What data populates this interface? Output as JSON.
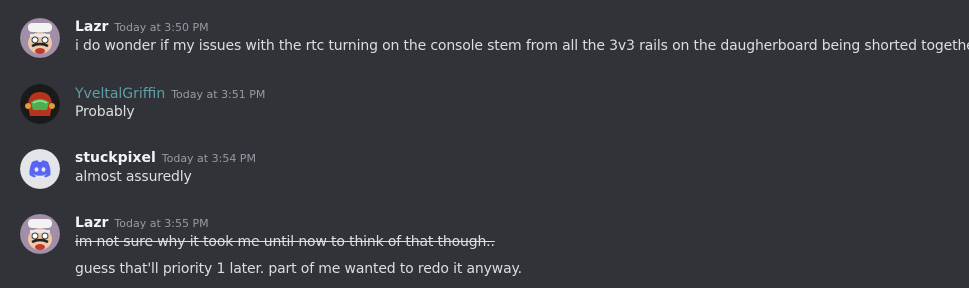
{
  "messages": [
    {
      "author": "Lazr",
      "timestamp": "Today at 3:50 PM",
      "avatar": "lazr-avatar",
      "lines": [
        {
          "text": "i do wonder if my issues with the rtc turning on the console stem from all the 3v3 rails on the daugherboard being shorted together",
          "strike": false
        }
      ]
    },
    {
      "author": "YveltalGriffin",
      "timestamp": "Today at 3:51 PM",
      "avatar": "helmet-avatar",
      "author_color": "#5e9ea6",
      "lines": [
        {
          "text": "Probably",
          "strike": false
        }
      ]
    },
    {
      "author": "stuckpixel",
      "timestamp": "Today at 3:54 PM",
      "avatar": "discord-default-avatar",
      "lines": [
        {
          "text": "almost assuredly",
          "strike": false
        }
      ]
    },
    {
      "author": "Lazr",
      "timestamp": "Today at 3:55 PM",
      "avatar": "lazr-avatar",
      "lines": [
        {
          "text": "im not sure why it took me until now to think of that though..",
          "strike": true
        },
        {
          "text": "guess that'll priority 1 later. part of me wanted to redo it anyway.",
          "strike": false
        }
      ]
    }
  ],
  "colors": {
    "background": "#313338",
    "text": "#dbdee1",
    "timestamp": "#949ba4",
    "discord_blurple": "#5865f2"
  }
}
